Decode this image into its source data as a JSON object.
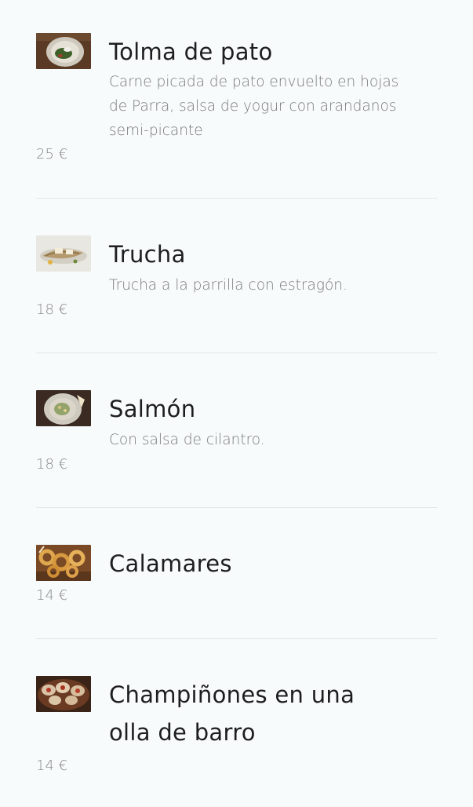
{
  "menu": {
    "items": [
      {
        "name": "Tolma de pato",
        "description": "Carne picada de pato envuelto en hojas de Parra, salsa de yogur con arandanos semi-picante",
        "price": "25 €",
        "image_icon": "dish-photo-icon"
      },
      {
        "name": "Trucha",
        "description": "Trucha a la parrilla con estragón.",
        "price": "18 €",
        "image_icon": "dish-photo-icon"
      },
      {
        "name": "Salmón",
        "description": "Con salsa de cilantro.",
        "price": "18 €",
        "image_icon": "dish-photo-icon"
      },
      {
        "name": "Calamares",
        "description": "",
        "price": "14 €",
        "image_icon": "dish-photo-icon"
      },
      {
        "name": "Champiñones en una olla de barro",
        "description": "",
        "price": "14 €",
        "image_icon": "dish-photo-icon"
      }
    ]
  },
  "colors": {
    "background": "#f7fbfb",
    "title": "#1e1e1e",
    "description": "#7a7a7a",
    "price": "#888888",
    "divider": "#e3e8e8"
  }
}
